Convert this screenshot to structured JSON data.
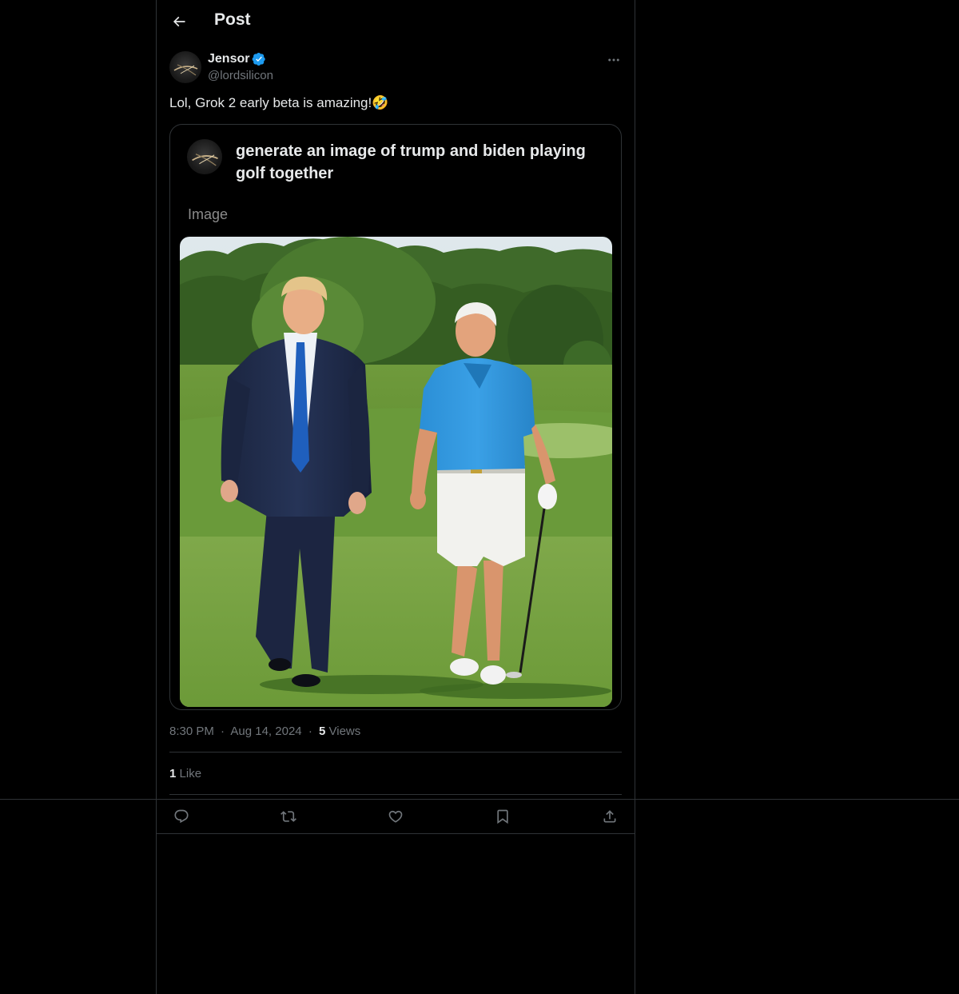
{
  "header": {
    "title": "Post",
    "back_icon": "arrow-left-icon"
  },
  "post": {
    "author_name": "Jensor",
    "author_handle": "@lordsilicon",
    "verified_icon": "verified-badge-icon",
    "more_icon": "more-horizontal-icon",
    "text": "Lol, Grok 2 early beta is amazing!🤣",
    "media": {
      "prompt": "generate an image of trump and biden playing golf together",
      "image_label": "Image"
    },
    "time": "8:30 PM",
    "date": "Aug 14, 2024",
    "separator": "·",
    "views_count": "5",
    "views_label": "Views",
    "likes_count": "1",
    "likes_label": "Like"
  },
  "actions": [
    {
      "name": "reply",
      "icon": "reply-icon"
    },
    {
      "name": "repost",
      "icon": "repost-icon"
    },
    {
      "name": "like",
      "icon": "heart-icon"
    },
    {
      "name": "bookmark",
      "icon": "bookmark-icon"
    },
    {
      "name": "share",
      "icon": "share-icon"
    }
  ],
  "colors": {
    "background": "#000000",
    "text": "#e7e9ea",
    "secondary": "#71767b",
    "border": "#2f3336",
    "verified": "#1d9bf0"
  }
}
